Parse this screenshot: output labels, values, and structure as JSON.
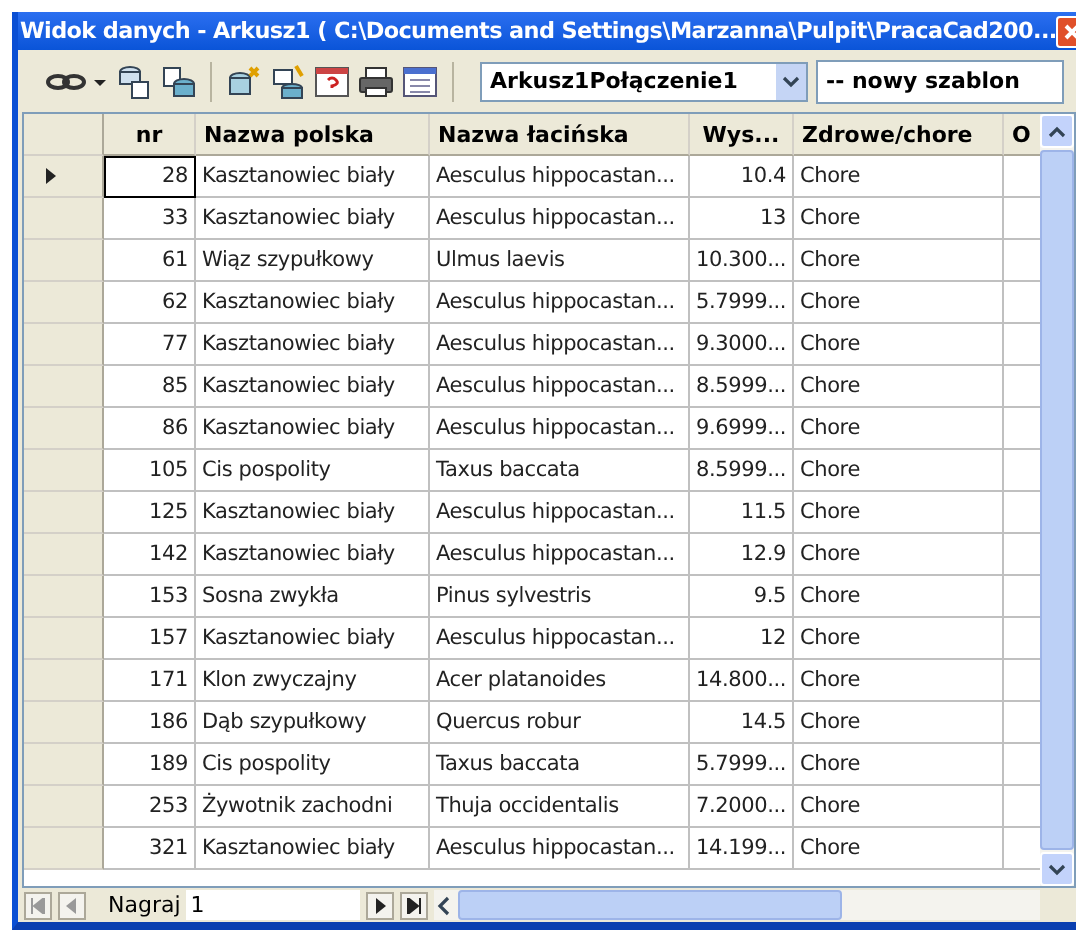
{
  "window": {
    "title": "Widok danych - Arkusz1 ( C:\\Documents and Settings\\Marzanna\\Pulpit\\PracaCad200..."
  },
  "toolbar": {
    "connection": "Arkusz1Połączenie1",
    "template": "-- nowy szablon"
  },
  "table": {
    "columns": [
      {
        "label": "nr"
      },
      {
        "label": "Nazwa polska"
      },
      {
        "label": "Nazwa łacińska"
      },
      {
        "label": "Wys..."
      },
      {
        "label": "Zdrowe/chore"
      },
      {
        "label": "O"
      }
    ],
    "rows": [
      {
        "selected": true,
        "cells": [
          "28",
          "Kasztanowiec biały",
          "Aesculus hippocastan...",
          "10.4",
          "Chore"
        ]
      },
      {
        "selected": false,
        "cells": [
          "33",
          "Kasztanowiec biały",
          "Aesculus hippocastan...",
          "13",
          "Chore"
        ]
      },
      {
        "selected": false,
        "cells": [
          "61",
          "Wiąz szypułkowy",
          "Ulmus laevis",
          "10.300...",
          "Chore"
        ]
      },
      {
        "selected": false,
        "cells": [
          "62",
          "Kasztanowiec biały",
          "Aesculus hippocastan...",
          "5.7999...",
          "Chore"
        ]
      },
      {
        "selected": false,
        "cells": [
          "77",
          "Kasztanowiec biały",
          "Aesculus hippocastan...",
          "9.3000...",
          "Chore"
        ]
      },
      {
        "selected": false,
        "cells": [
          "85",
          "Kasztanowiec biały",
          "Aesculus hippocastan...",
          "8.5999...",
          "Chore"
        ]
      },
      {
        "selected": false,
        "cells": [
          "86",
          "Kasztanowiec biały",
          "Aesculus hippocastan...",
          "9.6999...",
          "Chore"
        ]
      },
      {
        "selected": false,
        "cells": [
          "105",
          "Cis pospolity",
          "Taxus baccata",
          "8.5999...",
          "Chore"
        ]
      },
      {
        "selected": false,
        "cells": [
          "125",
          "Kasztanowiec biały",
          "Aesculus hippocastan...",
          "11.5",
          "Chore"
        ]
      },
      {
        "selected": false,
        "cells": [
          "142",
          "Kasztanowiec biały",
          "Aesculus hippocastan...",
          "12.9",
          "Chore"
        ]
      },
      {
        "selected": false,
        "cells": [
          "153",
          "Sosna zwykła",
          "Pinus sylvestris",
          "9.5",
          "Chore"
        ]
      },
      {
        "selected": false,
        "cells": [
          "157",
          "Kasztanowiec biały",
          "Aesculus hippocastan...",
          "12",
          "Chore"
        ]
      },
      {
        "selected": false,
        "cells": [
          "171",
          "Klon zwyczajny",
          "Acer platanoides",
          "14.800...",
          "Chore"
        ]
      },
      {
        "selected": false,
        "cells": [
          "186",
          "Dąb szypułkowy",
          "Quercus robur",
          "14.5",
          "Chore"
        ]
      },
      {
        "selected": false,
        "cells": [
          "189",
          "Cis pospolity",
          "Taxus baccata",
          "5.7999...",
          "Chore"
        ]
      },
      {
        "selected": false,
        "cells": [
          "253",
          "Żywotnik zachodni",
          "Thuja occidentalis",
          "7.2000...",
          "Chore"
        ]
      },
      {
        "selected": false,
        "cells": [
          "321",
          "Kasztanowiec biały",
          "Aesculus hippocastan...",
          "14.199...",
          "Chore"
        ]
      }
    ]
  },
  "navigator": {
    "label": "Nagraj",
    "record": "1"
  }
}
